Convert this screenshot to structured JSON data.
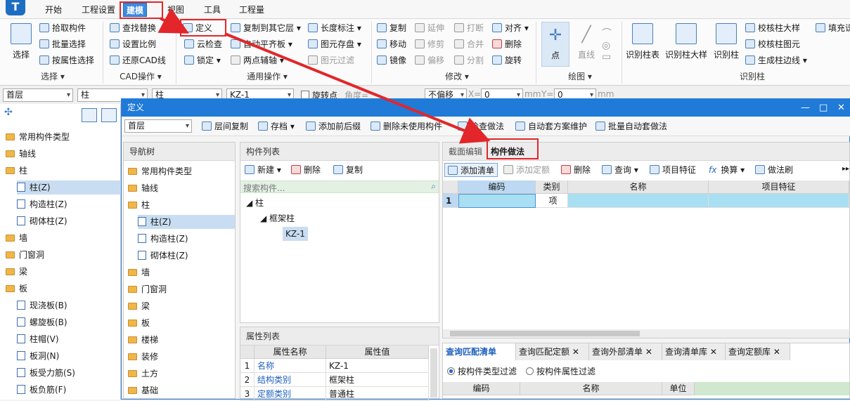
{
  "menu": {
    "tabs": [
      "开始",
      "工程设置",
      "建模",
      "视图",
      "工具",
      "工程量"
    ]
  },
  "ribbon": {
    "select_btn": "选择",
    "pick": "拾取构件",
    "batch": "批量选择",
    "by_attr": "按属性选择",
    "group_select": "选择 ▾",
    "find_replace": "查找替换",
    "set_scale": "设置比例",
    "restore_cad": "还原CAD线",
    "group_cad": "CAD操作 ▾",
    "define": "定义",
    "cloud_check": "云检查",
    "lock": "锁定 ▾",
    "copy_to_layer": "复制到其它层 ▾",
    "auto_align_slab": "自动平齐板 ▾",
    "two_point_axis": "两点辅轴 ▾",
    "length_mark": "长度标注 ▾",
    "elem_save": "图元存盘 ▾",
    "elem_filter": "图元过滤",
    "group_common": "通用操作 ▾",
    "copy": "复制",
    "extend": "延伸",
    "break": "打断",
    "align": "对齐 ▾",
    "move": "移动",
    "trim": "修剪",
    "merge": "合并",
    "delete": "删除",
    "mirror": "镜像",
    "offset": "偏移",
    "split": "分割",
    "rotate": "旋转",
    "group_modify": "修改 ▾",
    "point": "点",
    "line": "直线",
    "group_draw": "绘图 ▾",
    "id_col_table": "识别柱表",
    "id_col_detail": "识别柱大样",
    "id_col": "识别柱",
    "check_col_detail": "校核柱大样",
    "check_col_elem": "校核柱图元",
    "gen_col_edge": "生成柱边线 ▾",
    "fill_detail": "填充识",
    "group_id_col": "识别柱"
  },
  "toolbar": {
    "floor": "首层",
    "type": "柱",
    "type2": "柱",
    "comp": "KZ-1",
    "rot": "旋转点",
    "angle": "角度=",
    "offset": "不偏移",
    "x": "X=",
    "xv": "0",
    "mm": "mm",
    "y": "Y=",
    "yv": "0",
    "mm2": "mm"
  },
  "left": {
    "items": [
      "常用构件类型",
      "轴线",
      "柱",
      "柱(Z)",
      "构造柱(Z)",
      "砌体柱(Z)",
      "墙",
      "门窗洞",
      "梁",
      "板",
      "现浇板(B)",
      "螺旋板(B)",
      "柱帽(V)",
      "板洞(N)",
      "板受力筋(S)",
      "板负筋(F)"
    ]
  },
  "dialog": {
    "title": "定义",
    "floor": "首层",
    "layer_copy": "层间复制",
    "save": "存档 ▾",
    "add_prefix": "添加前后缀",
    "del_unused": "删除未使用构件",
    "check_method": "检查做法",
    "auto_method": "自动套方案维护",
    "batch_auto": "批量自动套做法",
    "nav": {
      "title": "导航树",
      "items": [
        "常用构件类型",
        "轴线",
        "柱",
        "柱(Z)",
        "构造柱(Z)",
        "砌体柱(Z)",
        "墙",
        "门窗洞",
        "梁",
        "板",
        "楼梯",
        "装修",
        "土方",
        "基础"
      ]
    },
    "comp_list": {
      "title": "构件列表",
      "new": "新建 ▾",
      "delete": "删除",
      "copy": "复制",
      "search": "搜索构件...",
      "tree": [
        "柱",
        "框架柱",
        "KZ-1"
      ]
    },
    "props": {
      "title": "属性列表",
      "h_name": "属性名称",
      "h_val": "属性值",
      "rows": [
        {
          "no": "1",
          "name": "名称",
          "val": "KZ-1"
        },
        {
          "no": "2",
          "name": "结构类别",
          "val": "框架柱"
        },
        {
          "no": "3",
          "name": "定额类别",
          "val": "普通柱"
        }
      ]
    },
    "right": {
      "tab1": "截面编辑",
      "tab2": "构件做法",
      "add_list": "添加清单",
      "add_quota": "添加定额",
      "delete": "删除",
      "query": "查询 ▾",
      "item_feature": "项目特征",
      "convert": "换算 ▾",
      "method_brush": "做法刷",
      "h_code": "编码",
      "h_type": "类别",
      "h_name": "名称",
      "h_feature": "项目特征",
      "row1_no": "1",
      "row1_type": "项"
    },
    "bottom": {
      "tabs": [
        "查询匹配清单",
        "查询匹配定额",
        "查询外部清单",
        "查询清单库",
        "查询定额库"
      ],
      "filter1": "按构件类型过滤",
      "filter2": "按构件属性过滤",
      "h_code": "编码",
      "h_name": "名称",
      "h_unit": "单位"
    }
  }
}
